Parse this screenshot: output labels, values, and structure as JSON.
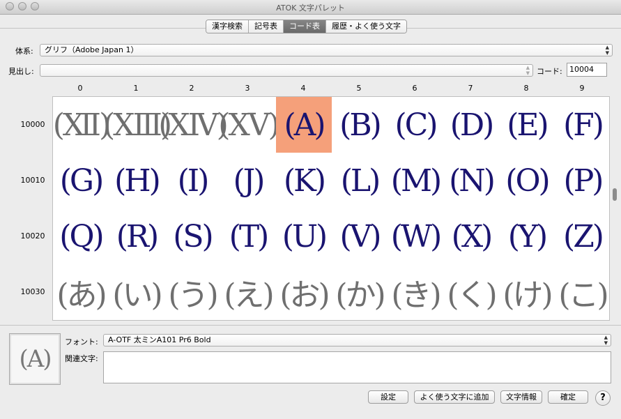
{
  "window": {
    "title": "ATOK 文字パレット"
  },
  "tabs": [
    {
      "label": "漢字検索",
      "active": false
    },
    {
      "label": "記号表",
      "active": false
    },
    {
      "label": "コード表",
      "active": true
    },
    {
      "label": "履歴・よく使う文字",
      "active": false
    }
  ],
  "system": {
    "label": "体系:",
    "value": "グリフ（Adobe Japan 1）"
  },
  "heading": {
    "label": "見出し:",
    "value": ""
  },
  "code": {
    "label": "コード:",
    "value": "10004"
  },
  "columns": [
    "0",
    "1",
    "2",
    "3",
    "4",
    "5",
    "6",
    "7",
    "8",
    "9"
  ],
  "rows": [
    {
      "code": "10000",
      "cells": [
        "(Ⅻ)",
        "(ⅩⅢ)",
        "(ⅩⅣ)",
        "(ⅩⅤ)",
        "(A)",
        "(B)",
        "(C)",
        "(D)",
        "(E)",
        "(F)"
      ]
    },
    {
      "code": "10010",
      "cells": [
        "(G)",
        "(H)",
        "(I)",
        "(J)",
        "(K)",
        "(L)",
        "(M)",
        "(N)",
        "(O)",
        "(P)"
      ]
    },
    {
      "code": "10020",
      "cells": [
        "(Q)",
        "(R)",
        "(S)",
        "(T)",
        "(U)",
        "(V)",
        "(W)",
        "(X)",
        "(Y)",
        "(Z)"
      ]
    },
    {
      "code": "10030",
      "cells": [
        "(あ)",
        "(い)",
        "(う)",
        "(え)",
        "(お)",
        "(か)",
        "(き)",
        "(く)",
        "(け)",
        "(こ)"
      ]
    }
  ],
  "selected": {
    "row": 0,
    "col": 4
  },
  "colors": {
    "glyph_blue": "#1a1470",
    "glyph_gray": "#6f6f6f",
    "selection": "#f5a07a"
  },
  "preview": {
    "glyph": "(A)"
  },
  "font": {
    "label": "フォント:",
    "value": "A-OTF 太ミンA101 Pr6 Bold"
  },
  "related": {
    "label": "関連文字:",
    "value": ""
  },
  "buttons": {
    "settings": "設定",
    "add_favorite": "よく使う文字に追加",
    "char_info": "文字情報",
    "confirm": "確定",
    "help": "?"
  }
}
